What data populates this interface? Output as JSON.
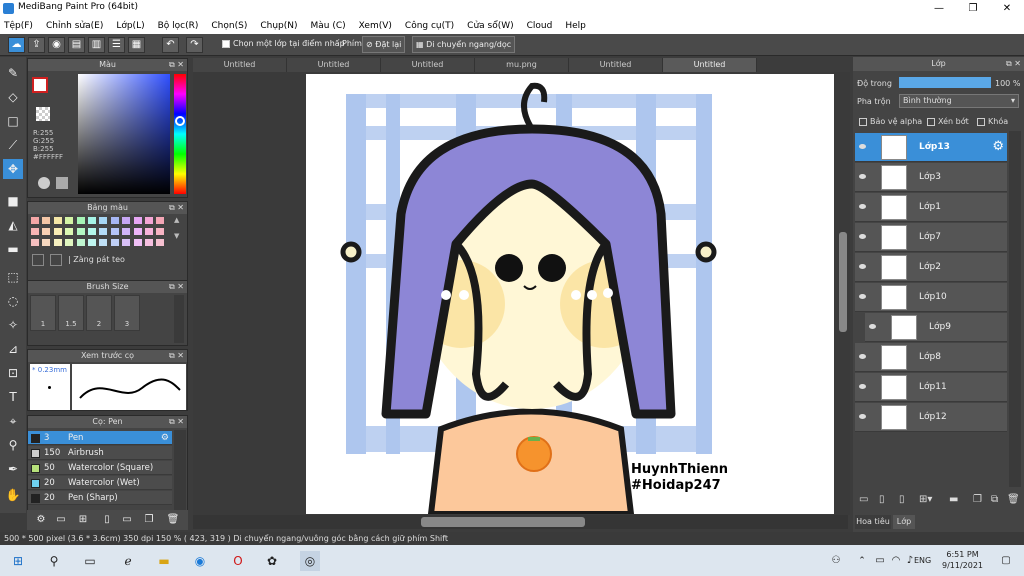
{
  "titlebar": {
    "title": "MediBang Paint Pro (64bit)",
    "min": "—",
    "max": "❐",
    "close": "✕"
  },
  "menu": [
    "Tệp(F)",
    "Chỉnh sửa(E)",
    "Lớp(L)",
    "Bộ lọc(R)",
    "Chọn(S)",
    "Chụp(N)",
    "Màu (C)",
    "Xem(V)",
    "Công cụ(T)",
    "Cửa sổ(W)",
    "Cloud",
    "Help"
  ],
  "toolbar": {
    "select_layer_label": "Chọn một lớp tại điểm nhấp",
    "snap_label": "Phím",
    "reset_label": "Đặt lại",
    "move_label": "Di chuyển ngang/dọc"
  },
  "color_panel": {
    "title": "Màu",
    "r": "R:255",
    "g": "G:255",
    "b": "B:255",
    "hex": "#FFFFFF"
  },
  "palette_panel": {
    "title": "Bảng màu",
    "item": "Zàng pát teo"
  },
  "brush_size_panel": {
    "title": "Brush Size",
    "sizes": [
      "1",
      "1.5",
      "2",
      "3"
    ]
  },
  "preview_panel": {
    "title": "Xem trước cọ",
    "size": "0.23mm"
  },
  "brush_panel": {
    "title": "Cọ: Pen",
    "brushes": [
      {
        "size": "3",
        "name": "Pen",
        "color": "#222222",
        "selected": true
      },
      {
        "size": "150",
        "name": "Airbrush",
        "color": "#cccccc",
        "selected": false
      },
      {
        "size": "50",
        "name": "Watercolor (Square)",
        "color": "#b6e07a",
        "selected": false
      },
      {
        "size": "20",
        "name": "Watercolor (Wet)",
        "color": "#6fd1f0",
        "selected": false
      },
      {
        "size": "20",
        "name": "Pen (Sharp)",
        "color": "#222222",
        "selected": false
      }
    ]
  },
  "tabs": [
    "Untitled",
    "Untitled",
    "Untitled",
    "mu.png",
    "Untitled",
    "Untitled"
  ],
  "canvas": {
    "signature_line1": "HuynhThienn",
    "signature_line2": "#Hoidap247"
  },
  "layer_panel": {
    "title": "Lớp",
    "opacity_label": "Độ trong",
    "opacity_value": "100 %",
    "opacity_fill": 1.0,
    "blend_label": "Pha trộn",
    "blend_value": "Bình thường",
    "protect_alpha": "Bảo vệ alpha",
    "clip": "Xén bớt",
    "lock": "Khóa",
    "layers": [
      {
        "name": "Lớp13",
        "selected": true
      },
      {
        "name": "Lớp3",
        "selected": false
      },
      {
        "name": "Lớp1",
        "selected": false
      },
      {
        "name": "Lớp7",
        "selected": false
      },
      {
        "name": "Lớp2",
        "selected": false
      },
      {
        "name": "Lớp10",
        "selected": false
      },
      {
        "name": "Lớp9",
        "selected": false
      },
      {
        "name": "Lớp8",
        "selected": false
      },
      {
        "name": "Lớp11",
        "selected": false
      },
      {
        "name": "Lớp12",
        "selected": false
      }
    ],
    "bottom_tab1": "Hoa tiêu",
    "bottom_tab2": "Lớp"
  },
  "status": {
    "text": "500 * 500 pixel   (3.6 * 3.6cm)   350 dpi   150 %   ( 423, 319 )   Di chuyển ngang/vuông góc bằng cách giữ phím Shift"
  },
  "taskbar": {
    "lang": "ENG",
    "time": "6:51 PM",
    "date": "9/11/2021"
  }
}
